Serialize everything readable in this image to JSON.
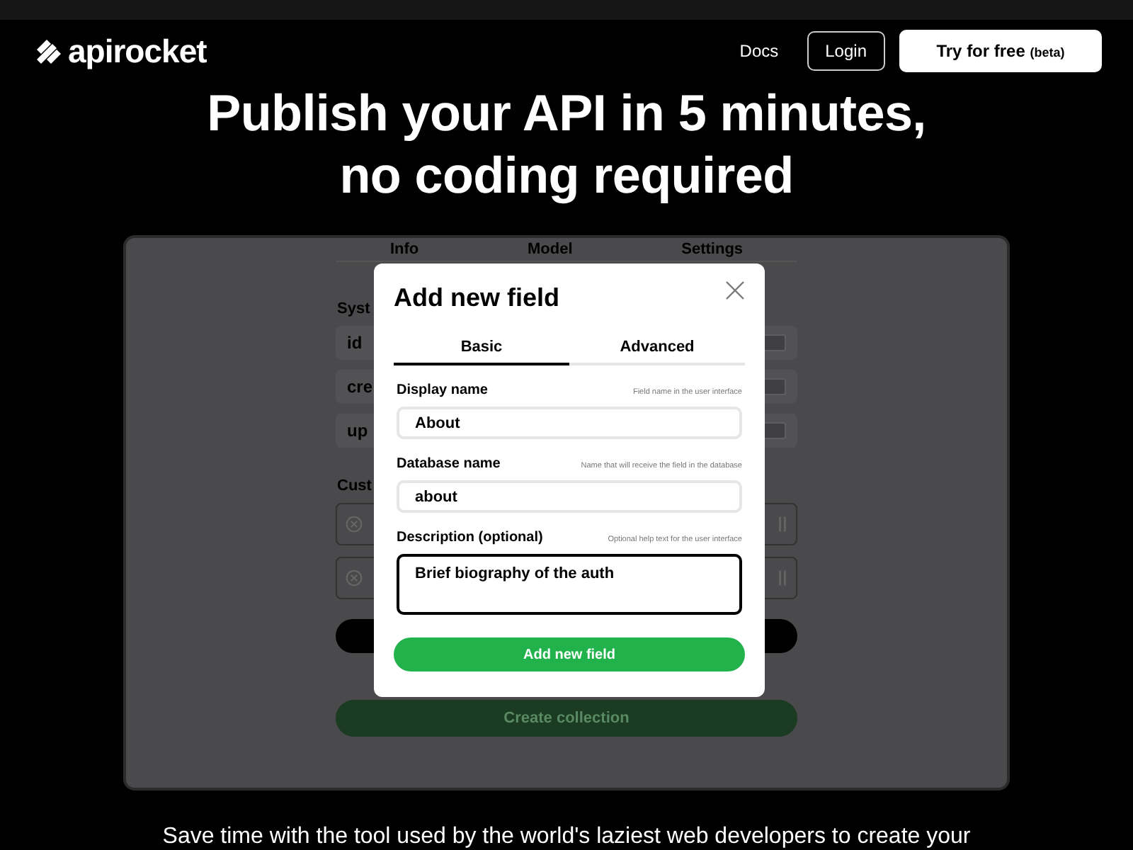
{
  "nav": {
    "logo": "apirocket",
    "links": [
      {
        "label": "Docs",
        "kind": "link"
      },
      {
        "label": "Login",
        "kind": "outline"
      },
      {
        "label": "Try for free",
        "note": "(beta)",
        "kind": "primary"
      }
    ]
  },
  "hero": {
    "title_lines": [
      "Publish your API in 5 minutes,",
      "no coding required"
    ]
  },
  "editor": {
    "tabs": [
      "Info",
      "Model",
      "Settings"
    ],
    "system_label": "Syst",
    "system_rows": [
      "id",
      "cre",
      "up"
    ],
    "custom_label": "Cust",
    "custom_rows": [
      {
        "kind": "custom"
      },
      {
        "kind": "custom"
      }
    ],
    "create_button": {
      "label": "Create collection",
      "disabled": true
    }
  },
  "modal": {
    "title": "Add new field",
    "tabs": [
      {
        "label": "Basic",
        "selected": true
      },
      {
        "label": "Advanced",
        "selected": false
      }
    ],
    "fields": [
      {
        "label": "Display name",
        "hint": "Field name in the user interface",
        "value": "About",
        "kind": "input",
        "focused": false
      },
      {
        "label": "Database name",
        "hint": "Name that will receive the field in the database",
        "value": "about",
        "kind": "input",
        "focused": false
      },
      {
        "label": "Description (optional)",
        "hint": "Optional help text for the user interface",
        "value": "Brief biography of the auth",
        "kind": "textarea",
        "focused": true
      }
    ],
    "submit": "Add new field"
  },
  "tagline": "Save time with the tool used by the world's laziest web developers to create your"
}
